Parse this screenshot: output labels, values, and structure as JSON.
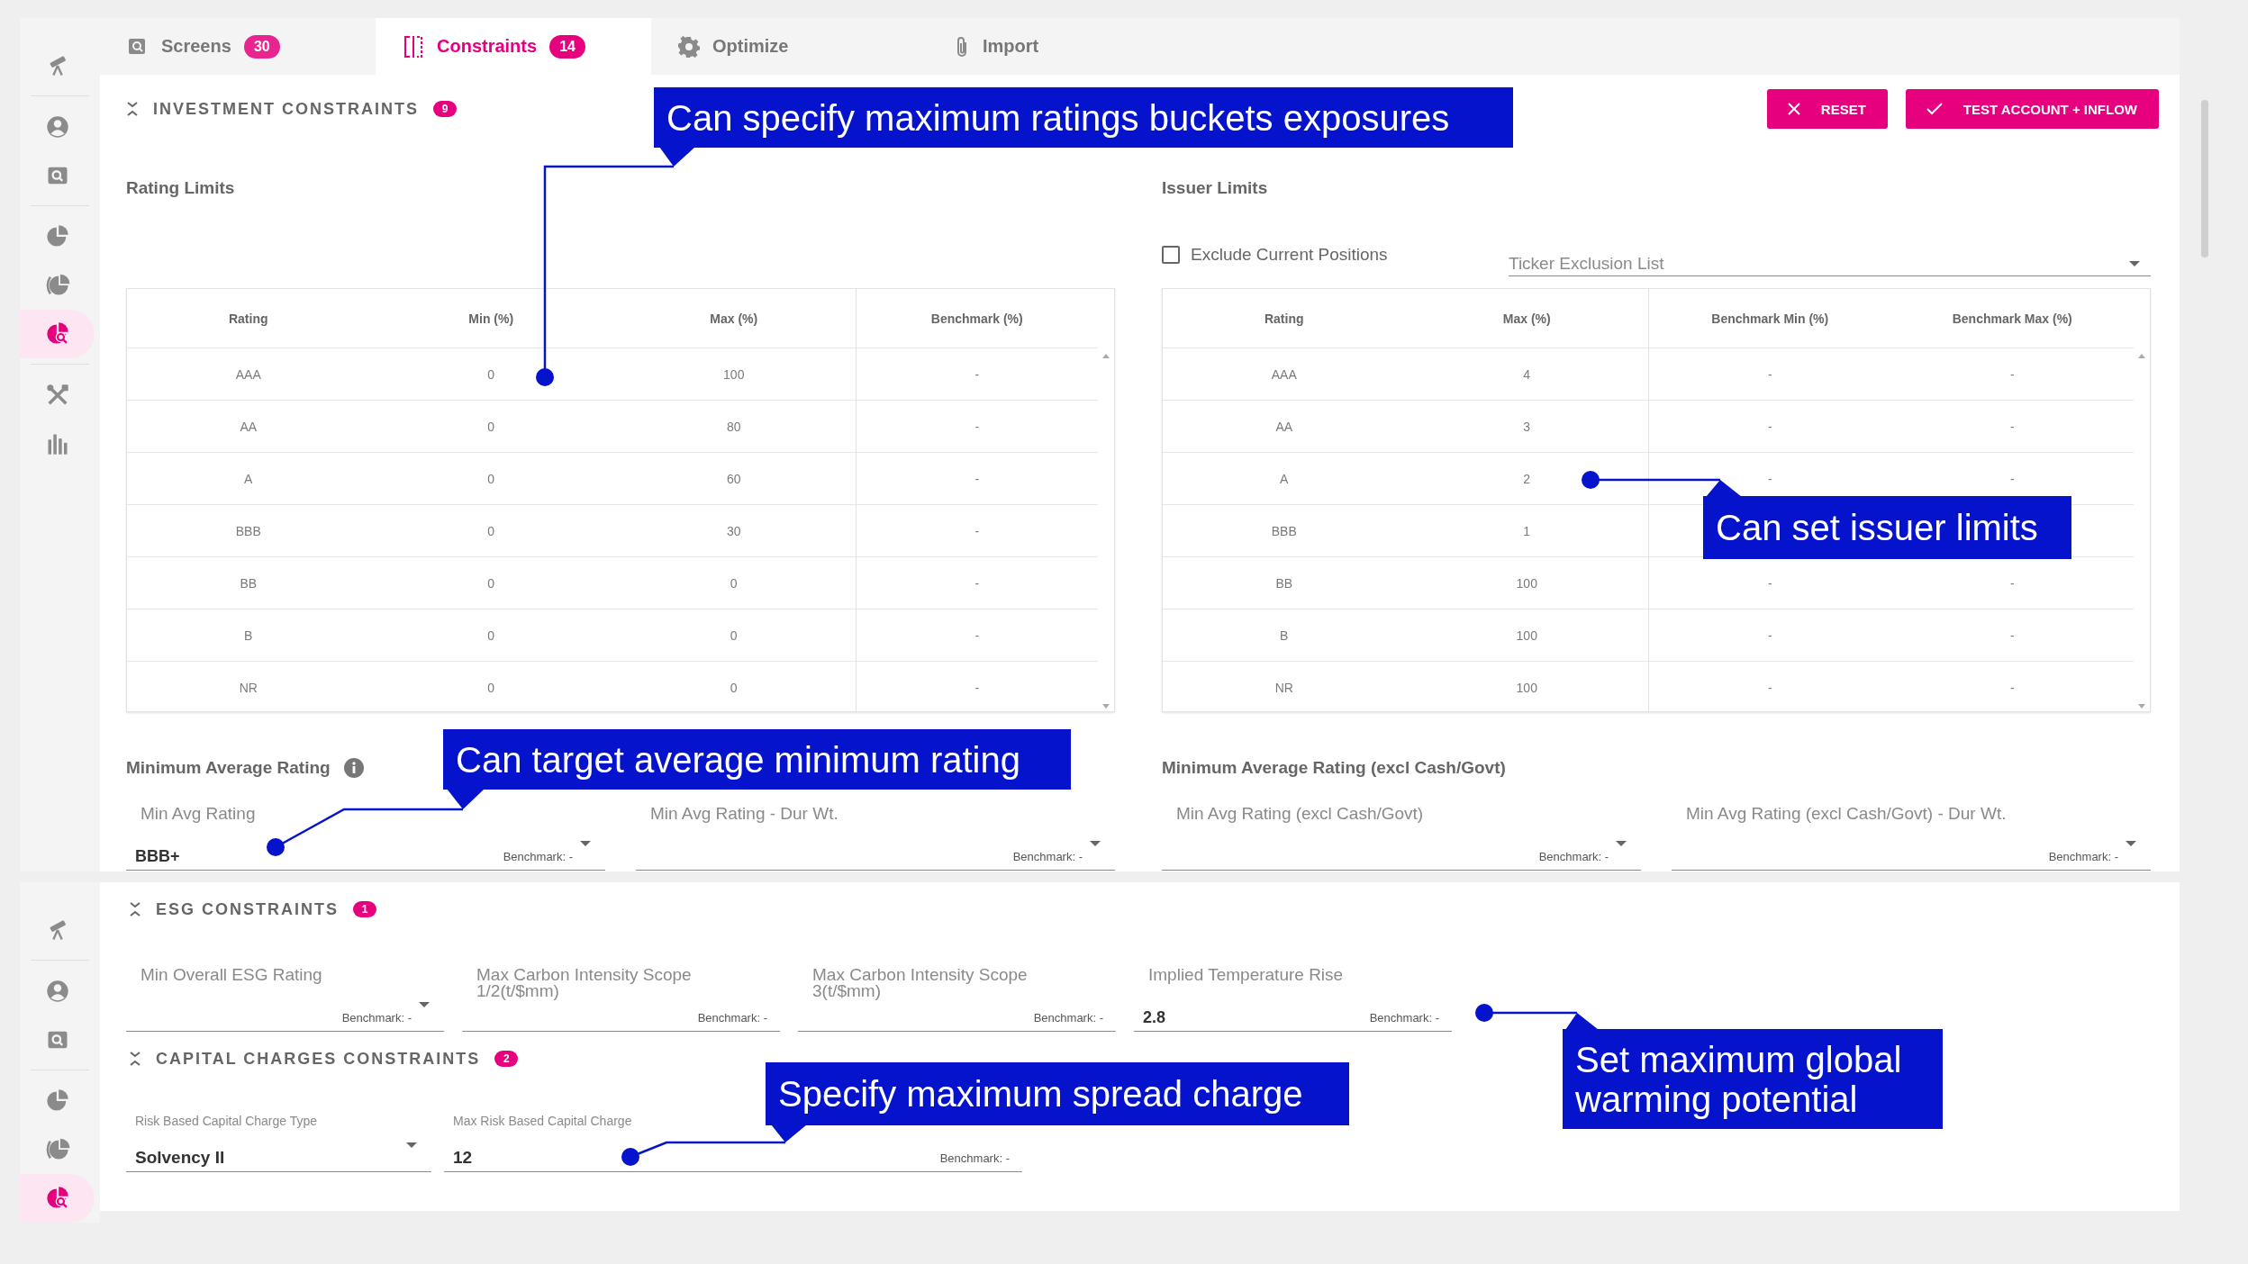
{
  "sidebars": [
    {
      "items": [
        {
          "selected": false
        },
        {
          "selected": false
        },
        {
          "selected": false
        },
        {
          "selected": false
        },
        {
          "selected": false
        },
        {
          "selected": true
        },
        {
          "selected": false
        },
        {
          "selected": false
        }
      ]
    },
    {
      "items": [
        {
          "selected": false
        },
        {
          "selected": false
        },
        {
          "selected": false
        },
        {
          "selected": false
        },
        {
          "selected": false
        },
        {
          "selected": true
        }
      ]
    }
  ],
  "tabs": [
    {
      "label": "Screens",
      "count": "30",
      "selected": false
    },
    {
      "label": "Constraints",
      "count": "14",
      "selected": true
    },
    {
      "label": "Optimize",
      "selected": false
    },
    {
      "label": "Import",
      "selected": false
    }
  ],
  "investment_constraints": {
    "title": "INVESTMENT CONSTRAINTS",
    "count": "9",
    "buttons": [
      {
        "label": "RESET",
        "kind": "reset"
      },
      {
        "label": "TEST ACCOUNT + INFLOW",
        "kind": "confirm"
      }
    ],
    "rating_limits": {
      "title": "Rating Limits",
      "table": {
        "columns": [
          "Rating",
          "Min (%)",
          "Max (%)",
          "Benchmark (%)"
        ],
        "rows": [
          [
            "AAA",
            "0",
            "100",
            "-"
          ],
          [
            "AA",
            "0",
            "80",
            "-"
          ],
          [
            "A",
            "0",
            "60",
            "-"
          ],
          [
            "BBB",
            "0",
            "30",
            "-"
          ],
          [
            "BB",
            "0",
            "0",
            "-"
          ],
          [
            "B",
            "0",
            "0",
            "-"
          ],
          [
            "NR",
            "0",
            "0",
            "-"
          ]
        ]
      }
    },
    "issuer_limits": {
      "title": "Issuer Limits",
      "exclude_current_positions": {
        "label": "Exclude Current Positions",
        "checked": false
      },
      "ticker_exclusion": {
        "placeholder": "Ticker Exclusion List"
      },
      "table": {
        "columns": [
          "Rating",
          "Max (%)",
          "Benchmark Min (%)",
          "Benchmark Max (%)"
        ],
        "rows": [
          [
            "AAA",
            "4",
            "-",
            "-"
          ],
          [
            "AA",
            "3",
            "-",
            "-"
          ],
          [
            "A",
            "2",
            "-",
            "-"
          ],
          [
            "BBB",
            "1"
          ],
          [
            "BB",
            "100",
            "-",
            "-"
          ],
          [
            "B",
            "100",
            "-",
            "-"
          ],
          [
            "NR",
            "100",
            "-",
            "-"
          ]
        ]
      }
    },
    "minimum_average_rating": {
      "title": "Minimum Average Rating",
      "fields": [
        {
          "kind": "select",
          "label": "Min Avg Rating",
          "value": "BBB+",
          "benchmark": "Benchmark: -"
        },
        {
          "kind": "select",
          "label": "Min Avg Rating - Dur Wt.",
          "benchmark": "Benchmark: -"
        }
      ]
    },
    "minimum_average_rating_excl": {
      "title": "Minimum Average Rating (excl Cash/Govt)",
      "fields": [
        {
          "kind": "select",
          "label": "Min Avg Rating (excl Cash/Govt)",
          "benchmark": "Benchmark: -"
        },
        {
          "kind": "select",
          "label": "Min Avg Rating (excl Cash/Govt) - Dur Wt.",
          "benchmark": "Benchmark: -"
        }
      ]
    }
  },
  "esg_constraints": {
    "title": "ESG CONSTRAINTS",
    "count": "1",
    "fields": [
      {
        "kind": "select",
        "label": "Min Overall ESG Rating",
        "benchmark": "Benchmark: -"
      },
      {
        "kind": "input",
        "label": "Max Carbon Intensity Scope 1/2(t/$mm)",
        "benchmark": "Benchmark: -"
      },
      {
        "kind": "input",
        "label": "Max Carbon Intensity Scope 3(t/$mm)",
        "benchmark": "Benchmark: -"
      },
      {
        "kind": "input",
        "label": "Implied Temperature Rise",
        "value": "2.8",
        "benchmark": "Benchmark: -"
      }
    ]
  },
  "capital_charges_constraints": {
    "title": "CAPITAL CHARGES CONSTRAINTS",
    "count": "2",
    "fields": [
      {
        "kind": "select",
        "label": "Risk Based Capital Charge Type",
        "value": "Solvency II"
      },
      {
        "kind": "input",
        "label": "Max Risk Based Capital Charge",
        "value": "12",
        "benchmark": "Benchmark: -"
      }
    ]
  },
  "callouts": [
    {
      "text": "Can specify maximum ratings buckets exposures"
    },
    {
      "text": "Can set issuer limits"
    },
    {
      "text": "Can target average minimum rating"
    },
    {
      "text": "Specify maximum spread charge"
    },
    {
      "text": "Set maximum global warming potential"
    }
  ]
}
